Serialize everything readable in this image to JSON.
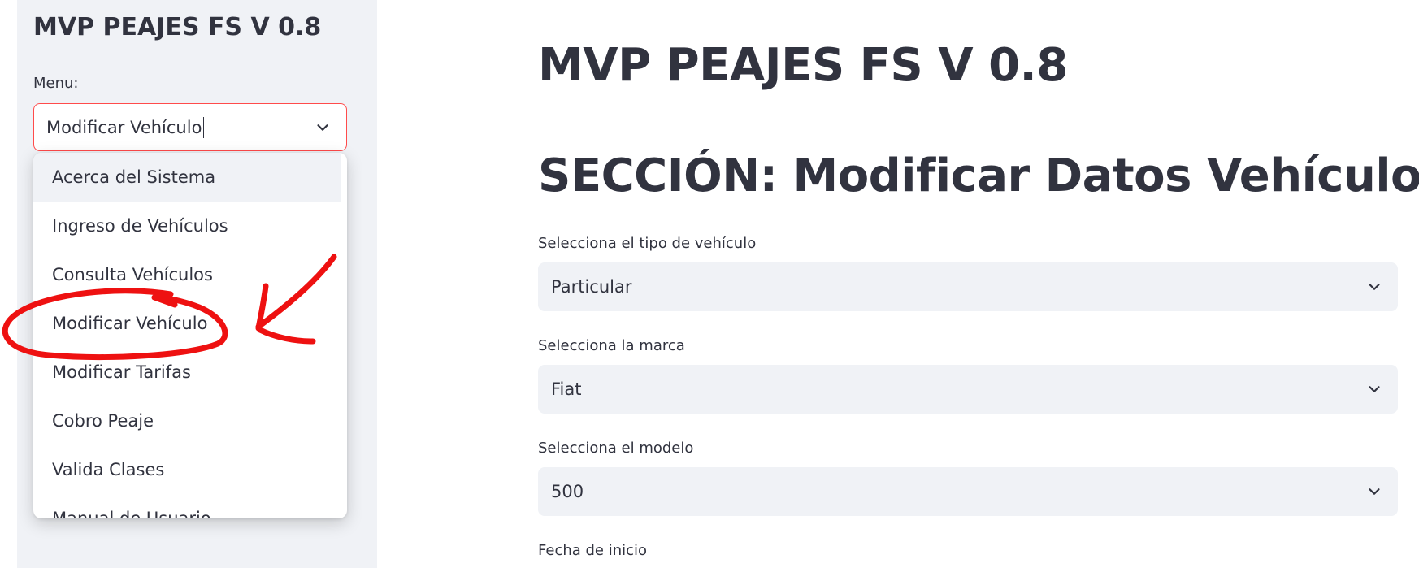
{
  "sidebar": {
    "title": "MVP PEAJES FS V 0.8",
    "menu_label": "Menu:",
    "selected_value": "Modificar Vehículo",
    "options": [
      "Acerca del Sistema",
      "Ingreso de Vehículos",
      "Consulta Vehículos",
      "Modificar Vehículo",
      "Modificar Tarifas",
      "Cobro Peaje",
      "Valida Clases",
      "Manual de Usuario"
    ]
  },
  "main": {
    "title": "MVP PEAJES FS V 0.8",
    "section_title": "SECCIÓN: Modificar Datos Vehículo",
    "fields": [
      {
        "label": "Selecciona el tipo de vehículo",
        "value": "Particular"
      },
      {
        "label": "Selecciona la marca",
        "value": "Fiat"
      },
      {
        "label": "Selecciona el modelo",
        "value": "500"
      },
      {
        "label": "Fecha de inicio"
      }
    ]
  },
  "colors": {
    "accent_border": "#ff4b4b",
    "sidebar_bg": "#f0f2f6",
    "text": "#31333f",
    "annotation_red": "#ee1111"
  },
  "icons": [
    "chevron-down-icon",
    "red-circle-annotation",
    "red-arrow-annotation"
  ]
}
